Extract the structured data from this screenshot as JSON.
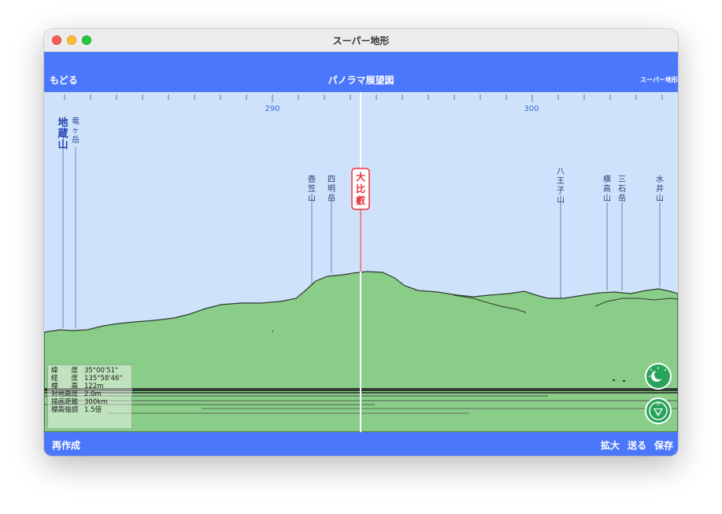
{
  "window": {
    "title": "スーパー地形"
  },
  "navbar": {
    "back_label": "もどる",
    "title": "パノラマ展望図",
    "right_label": "スーパー地形"
  },
  "scale": {
    "labels": [
      "290",
      "300"
    ]
  },
  "peaks": [
    {
      "name": "地蔵山",
      "style": "bold"
    },
    {
      "name": "竜ヶ岳",
      "style": "normal"
    },
    {
      "name": "壺笠山",
      "style": "normal"
    },
    {
      "name": "四明岳",
      "style": "normal"
    },
    {
      "name": "大比叡",
      "style": "highlight"
    },
    {
      "name": "八王子山",
      "style": "normal"
    },
    {
      "name": "横高山",
      "style": "normal"
    },
    {
      "name": "三石岳",
      "style": "normal"
    },
    {
      "name": "水井山",
      "style": "normal"
    }
  ],
  "info": {
    "lat_label": "緯　　度",
    "lat_value": "35°00'51\"",
    "lon_label": "経　　度",
    "lon_value": "135°58'46\"",
    "elev_label": "標　　高",
    "elev_value": "122m",
    "height_label": "対地高度",
    "height_value": "2.0m",
    "dist_label": "描画距離",
    "dist_value": "300km",
    "exag_label": "標高強調",
    "exag_value": "1.5倍"
  },
  "icons": {
    "moon_button": "moon-icon",
    "compass_button": "compass-icon"
  },
  "bottombar": {
    "rebuild_label": "再作成",
    "zoom_label": "拡大",
    "send_label": "送る",
    "save_label": "保存"
  },
  "colors": {
    "accent": "#4b77fb",
    "sky": "#cfe2fb",
    "terrain": "#8acd88",
    "highlight": "#e8323c"
  }
}
